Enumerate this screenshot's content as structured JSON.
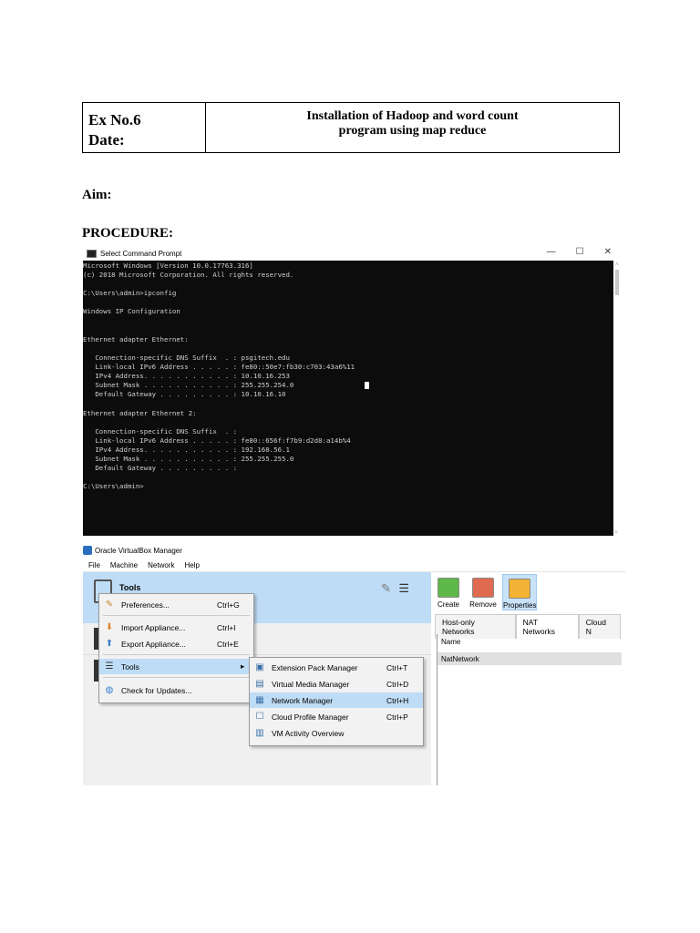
{
  "header": {
    "ex_no": "Ex No.6",
    "date": "Date:",
    "title_line1": "Installation of Hadoop and word count",
    "title_line2": "program using map reduce"
  },
  "aim_label": "Aim:",
  "procedure_label": "PROCEDURE:",
  "cmd": {
    "title": "Select Command Prompt",
    "lines": [
      "Microsoft Windows [Version 10.0.17763.316]",
      "(c) 2018 Microsoft Corporation. All rights reserved.",
      "",
      "C:\\Users\\admin>ipconfig",
      "",
      "Windows IP Configuration",
      "",
      "",
      "Ethernet adapter Ethernet:",
      "",
      "   Connection-specific DNS Suffix  . : psgitech.edu",
      "   Link-local IPv6 Address . . . . . : fe80::50e7:fb30:c703:43a6%11",
      "   IPv4 Address. . . . . . . . . . . : 10.10.16.253",
      "   Subnet Mask . . . . . . . . . . . : 255.255.254.0",
      "   Default Gateway . . . . . . . . . : 10.10.16.10",
      "",
      "Ethernet adapter Ethernet 2:",
      "",
      "   Connection-specific DNS Suffix  . :",
      "   Link-local IPv6 Address . . . . . : fe80::656f:f7b9:d2d8:a14b%4",
      "   IPv4 Address. . . . . . . . . . . : 192.168.56.1",
      "   Subnet Mask . . . . . . . . . . . : 255.255.255.0",
      "   Default Gateway . . . . . . . . . :",
      "",
      "C:\\Users\\admin>"
    ]
  },
  "vbox": {
    "title": "Oracle VirtualBox Manager",
    "menu": [
      "File",
      "Machine",
      "Network",
      "Help"
    ],
    "tools_label": "Tools",
    "toolbar": {
      "create": "Create",
      "remove": "Remove",
      "properties": "Properties"
    },
    "tabs": [
      "Host-only Networks",
      "NAT Networks",
      "Cloud N"
    ],
    "table_header": "Name",
    "table_rows": [
      "NatNetwork"
    ],
    "file_menu": [
      {
        "label": "Preferences...",
        "shortcut": "Ctrl+G",
        "icon": "wrench-icon"
      },
      {
        "label": "Import Appliance...",
        "shortcut": "Ctrl+I",
        "icon": "import-icon"
      },
      {
        "label": "Export Appliance...",
        "shortcut": "Ctrl+E",
        "icon": "export-icon"
      },
      {
        "label": "Tools",
        "shortcut": "",
        "icon": "list-icon"
      },
      {
        "label": "Check for Updates...",
        "shortcut": "",
        "icon": "globe-icon"
      }
    ],
    "tools_submenu": [
      {
        "label": "Extension Pack Manager",
        "shortcut": "Ctrl+T"
      },
      {
        "label": "Virtual Media Manager",
        "shortcut": "Ctrl+D"
      },
      {
        "label": "Network Manager",
        "shortcut": "Ctrl+H"
      },
      {
        "label": "Cloud Profile Manager",
        "shortcut": "Ctrl+P"
      },
      {
        "label": "VM Activity Overview",
        "shortcut": ""
      }
    ]
  }
}
